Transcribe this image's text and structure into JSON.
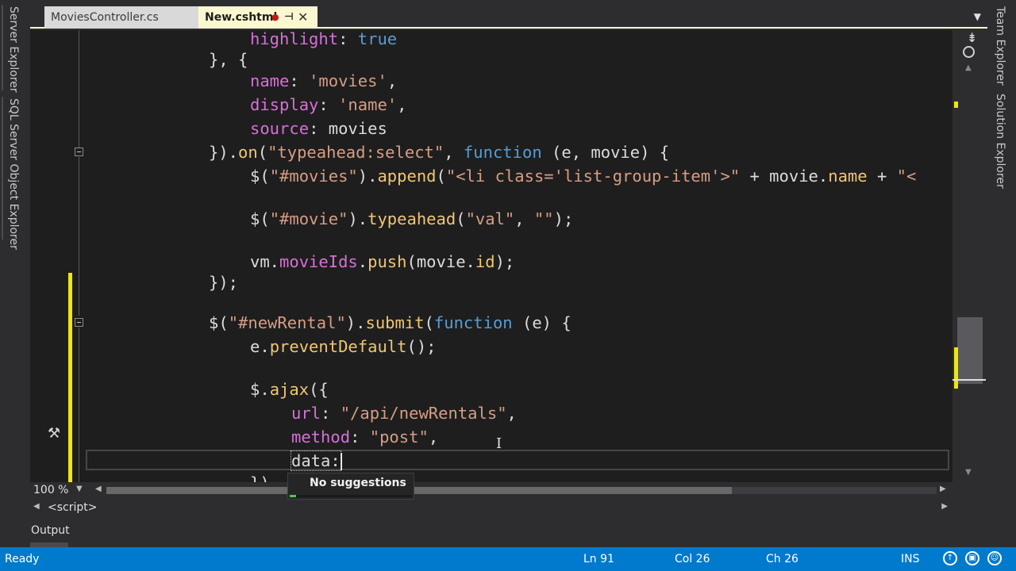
{
  "tabs": {
    "inactive_label": "MoviesController.cs",
    "active_label": "New.cshtml",
    "modified_marker": "●",
    "pin_glyph": "⊣",
    "close_glyph": "✕",
    "dropdown_glyph": "▼"
  },
  "side_panels": {
    "left": [
      "Server Explorer",
      "SQL Server Object Explorer"
    ],
    "right": [
      "Team Explorer",
      "Solution Explorer"
    ]
  },
  "editor": {
    "zoom": "100 %",
    "nav_context": "<script>",
    "current_input": "data:",
    "code": {
      "l1_a": "highlight",
      "l1_b": ": ",
      "l1_c": "true",
      "l2": "}, {",
      "l3_a": "name",
      "l3_b": ": ",
      "l3_c": "'movies'",
      "l3_d": ",",
      "l4_a": "display",
      "l4_b": ": ",
      "l4_c": "'name'",
      "l4_d": ",",
      "l5_a": "source",
      "l5_b": ": movies",
      "l6_a": "}).",
      "l6_b": "on",
      "l6_c": "(",
      "l6_d": "\"typeahead:select\"",
      "l6_e": ", ",
      "l6_f": "function",
      "l6_g": " (e, movie) {",
      "l7_a": "$(",
      "l7_b": "\"#movies\"",
      "l7_c": ").",
      "l7_d": "append",
      "l7_e": "(",
      "l7_f": "\"<li class='list-group-item'>\"",
      "l7_g": " + movie.",
      "l7_h": "name",
      "l7_i": " + ",
      "l7_j": "\"<",
      "l8_a": "$(",
      "l8_b": "\"#movie\"",
      "l8_c": ").",
      "l8_d": "typeahead",
      "l8_e": "(",
      "l8_f": "\"val\"",
      "l8_g": ", ",
      "l8_h": "\"\"",
      "l8_i": ");",
      "l9_a": "vm.",
      "l9_b": "movieIds",
      "l9_c": ".",
      "l9_d": "push",
      "l9_e": "(movie.",
      "l9_f": "id",
      "l9_g": ");",
      "l10": "});",
      "l11_a": "$(",
      "l11_b": "\"#newRental\"",
      "l11_c": ").",
      "l11_d": "submit",
      "l11_e": "(",
      "l11_f": "function",
      "l11_g": " (e) {",
      "l12_a": "e.",
      "l12_b": "preventDefault",
      "l12_c": "();",
      "l13_a": "$.",
      "l13_b": "ajax",
      "l13_c": "({",
      "l14_a": "url",
      "l14_b": ": ",
      "l14_c": "\"/api/newRentals\"",
      "l14_d": ",",
      "l15_a": "method",
      "l15_b": ": ",
      "l15_c": "\"post\"",
      "l15_d": ",",
      "l16_a": "data",
      "l16_b": ":",
      "l17": "})"
    }
  },
  "tooltip": {
    "text": "No suggestions",
    "progress": 0.05
  },
  "output_panel": {
    "title": "Output"
  },
  "statusbar": {
    "ready": "Ready",
    "line": "Ln 91",
    "col": "Col 26",
    "ch": "Ch 26",
    "mode": "INS"
  },
  "colors": {
    "status_bar": "#007acc",
    "change_marker": "#efe70b",
    "active_tab": "#fbf8d0"
  }
}
